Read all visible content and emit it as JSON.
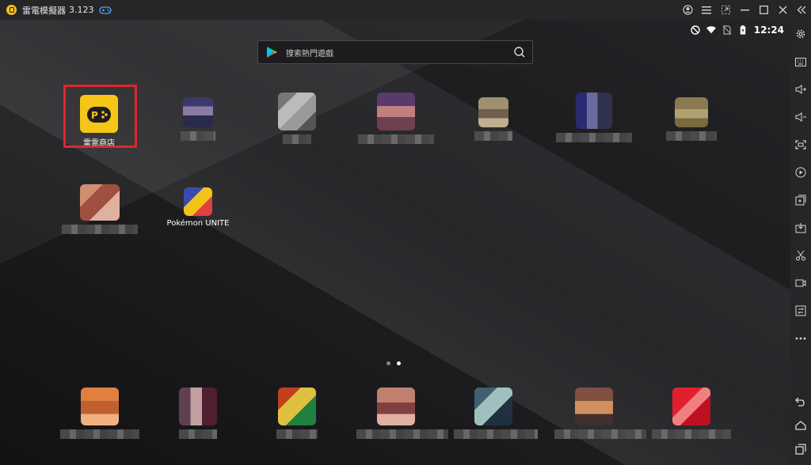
{
  "titlebar": {
    "app_name": "雷電模擬器",
    "version": "3.123"
  },
  "status": {
    "time": "12:24"
  },
  "search": {
    "placeholder": "搜索熱門遊戲"
  },
  "apps_row1": [
    {
      "label": "雷電商店",
      "blurred": false
    },
    {
      "label": "",
      "blurred": true
    },
    {
      "label": "",
      "blurred": true
    },
    {
      "label": "",
      "blurred": true
    },
    {
      "label": "",
      "blurred": true
    },
    {
      "label": "",
      "blurred": true
    },
    {
      "label": "",
      "blurred": true
    }
  ],
  "apps_row2": [
    {
      "label": "",
      "blurred": true
    },
    {
      "label": "Pokémon UNITE",
      "blurred": false
    }
  ],
  "dock_apps_count": 7,
  "page_indicator": {
    "pages": 2,
    "current": 2
  },
  "colors": {
    "highlight": "#e0262b",
    "ld_store": "#f5c518"
  },
  "icons": {
    "sidebar": [
      "settings-icon",
      "keyboard-icon",
      "volume-up-icon",
      "volume-down-icon",
      "fullscreen-icon",
      "record-icon",
      "add-app-icon",
      "apk-icon",
      "scissors-icon",
      "video-icon",
      "sync-icon",
      "more-icon",
      "back-icon",
      "home-icon",
      "recents-icon"
    ]
  }
}
